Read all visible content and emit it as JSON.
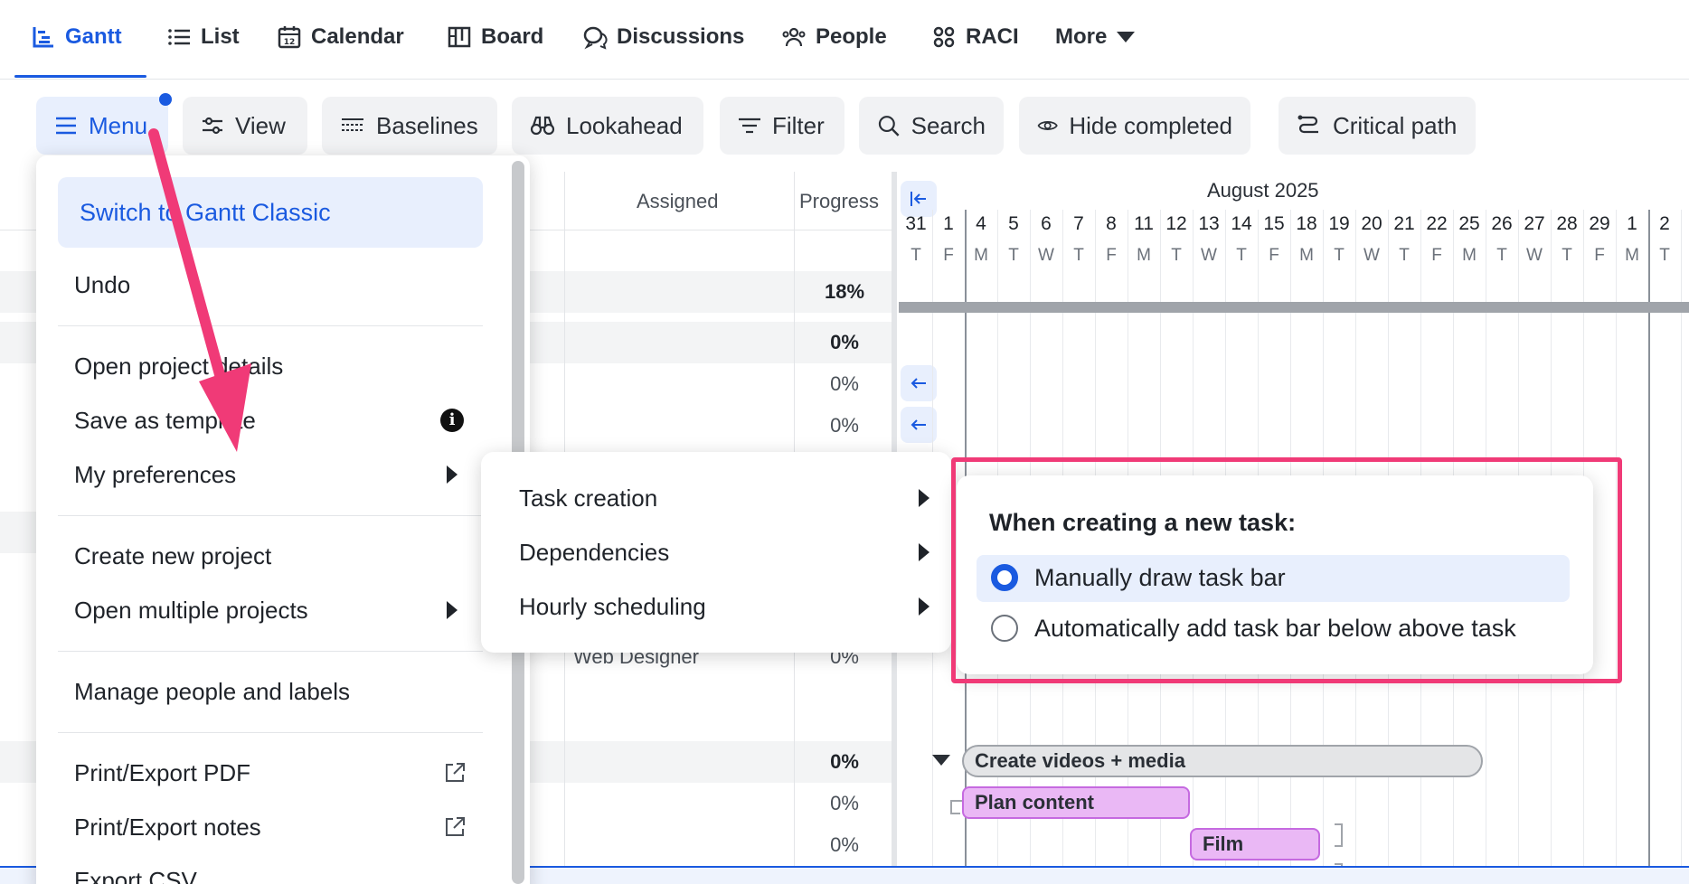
{
  "nav": {
    "items": [
      {
        "label": "Gantt",
        "icon": "gantt-icon",
        "active": true
      },
      {
        "label": "List",
        "icon": "list-icon"
      },
      {
        "label": "Calendar",
        "icon": "calendar-icon"
      },
      {
        "label": "Board",
        "icon": "board-icon"
      },
      {
        "label": "Discussions",
        "icon": "discussions-icon"
      },
      {
        "label": "People",
        "icon": "people-icon"
      },
      {
        "label": "RACI",
        "icon": "raci-icon"
      },
      {
        "label": "More",
        "icon": "caret-down-icon"
      }
    ]
  },
  "toolbar": {
    "menu": "Menu",
    "view": "View",
    "baselines": "Baselines",
    "lookahead": "Lookahead",
    "filter": "Filter",
    "search": "Search",
    "hide_completed": "Hide completed",
    "critical_path": "Critical path"
  },
  "columns": {
    "assigned": "Assigned",
    "progress": "Progress"
  },
  "rows": {
    "p1": "18%",
    "p2": "0%",
    "p3": "0%",
    "p4": "0%",
    "p5": "0%",
    "p6": "0%",
    "p7": "0%",
    "p8": "0%",
    "partial_assigned": "Web Designer"
  },
  "timeline": {
    "month": "August 2025",
    "days": [
      "31",
      "1",
      "4",
      "5",
      "6",
      "7",
      "8",
      "11",
      "12",
      "13",
      "14",
      "15",
      "18",
      "19",
      "20",
      "21",
      "22",
      "25",
      "26",
      "27",
      "28",
      "29",
      "1",
      "2"
    ],
    "letters": [
      "T",
      "F",
      "M",
      "T",
      "W",
      "T",
      "F",
      "M",
      "T",
      "W",
      "T",
      "F",
      "M",
      "T",
      "W",
      "T",
      "F",
      "M",
      "T",
      "W",
      "T",
      "F",
      "M",
      "T"
    ]
  },
  "bars": {
    "group": "Create videos + media",
    "plan": "Plan content",
    "film": "Film"
  },
  "menu": {
    "switch": "Switch to Gantt Classic",
    "undo": "Undo",
    "open_details": "Open project details",
    "save_template": "Save as template",
    "preferences": "My preferences",
    "create_project": "Create new project",
    "open_multiple": "Open multiple projects",
    "manage_people": "Manage people and labels",
    "print_pdf": "Print/Export PDF",
    "print_notes": "Print/Export notes",
    "export_csv": "Export CSV"
  },
  "submenu": {
    "task_creation": "Task creation",
    "dependencies": "Dependencies",
    "hourly": "Hourly scheduling"
  },
  "preference": {
    "title": "When creating a new task:",
    "opt_manual": "Manually draw task bar",
    "opt_auto": "Automatically add task bar below above task",
    "selected": "opt_manual"
  },
  "colors": {
    "accent": "#1a5ae0",
    "highlight": "#f03a77",
    "task_purple": "#eab8f5"
  }
}
